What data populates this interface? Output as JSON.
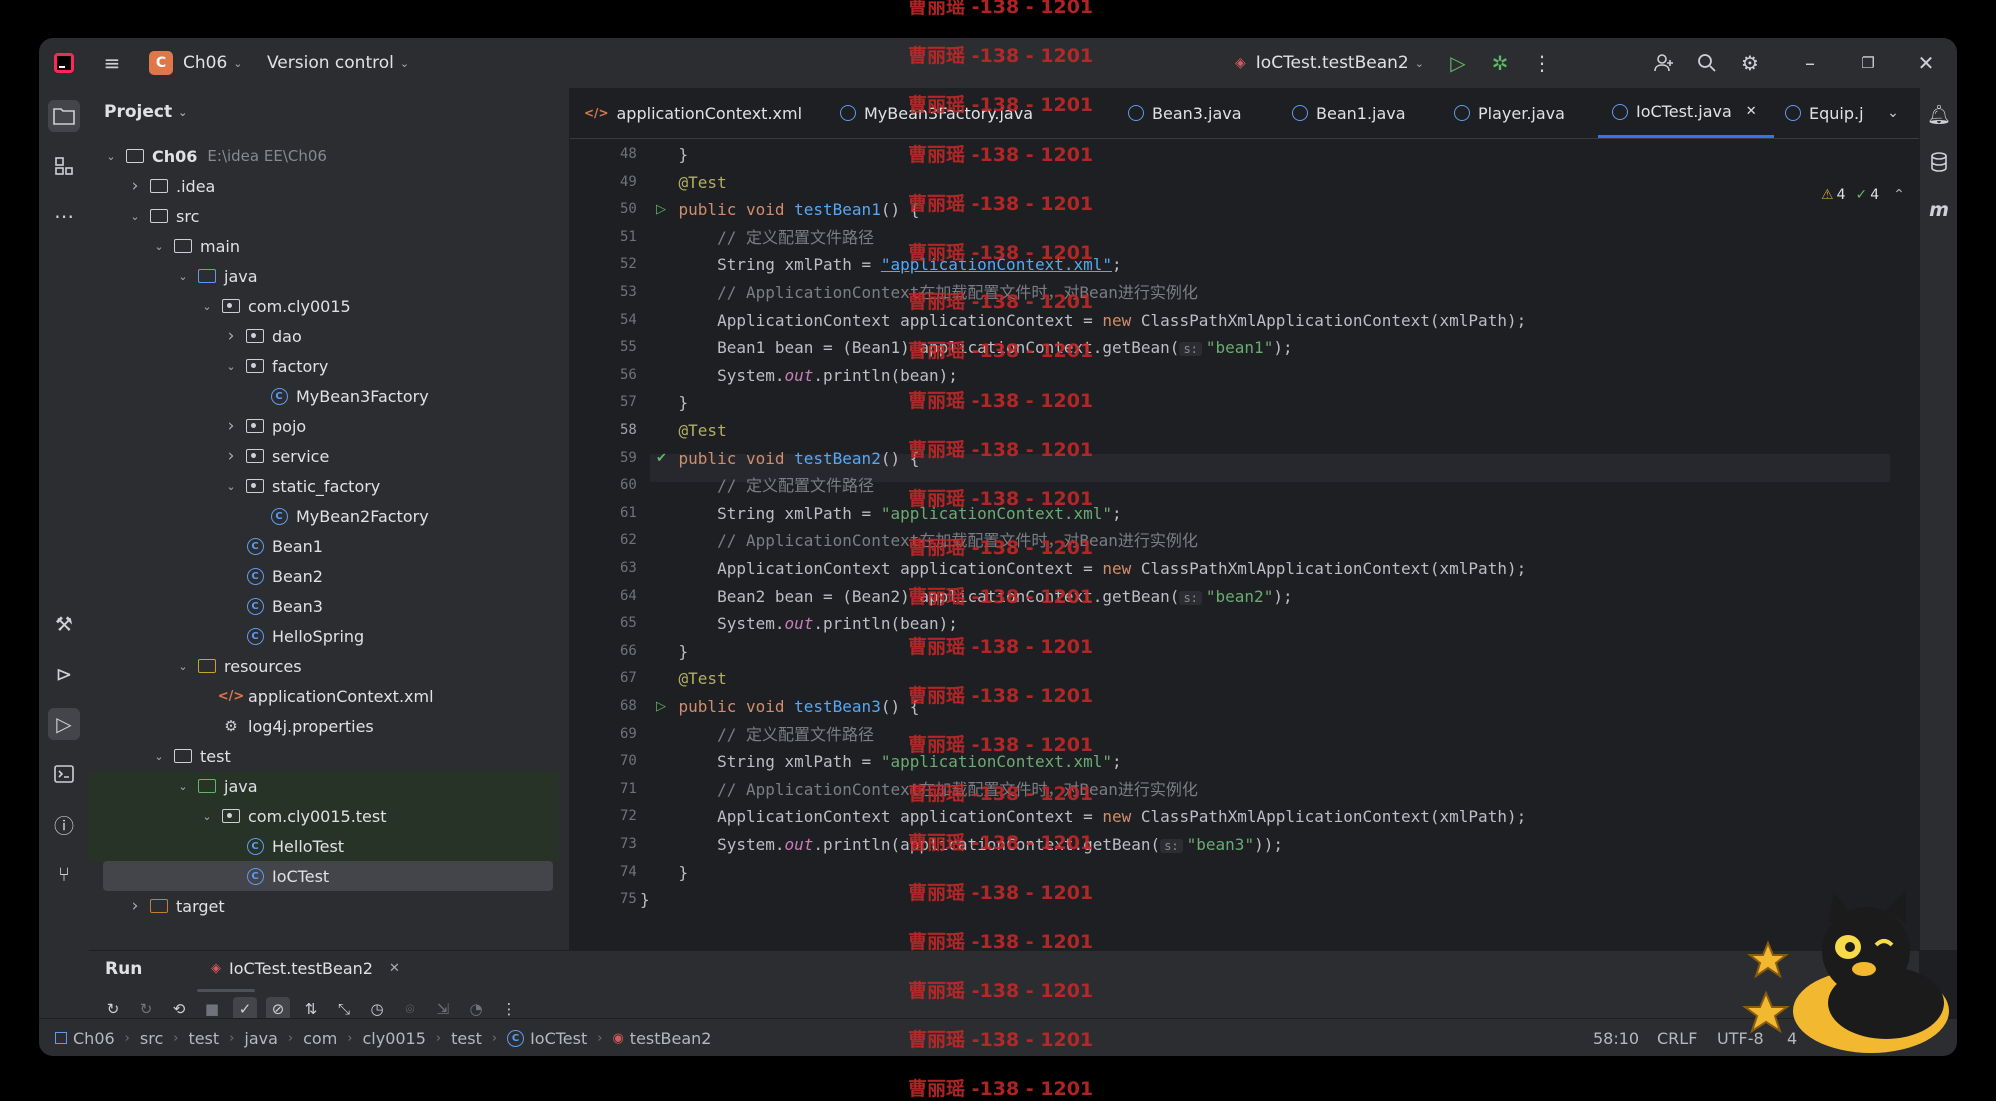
{
  "titlebar": {
    "project_initial": "C",
    "project_name": "Ch06",
    "vcs_label": "Version control",
    "run_config": "IoCTest.testBean2"
  },
  "project_panel": {
    "title": "Project",
    "tree": [
      {
        "label": "Ch06",
        "path": "E:\\idea EE\\Ch06",
        "depth": 0,
        "arrow": "down",
        "kind": "module"
      },
      {
        "label": ".idea",
        "depth": 1,
        "arrow": "right",
        "kind": "folder"
      },
      {
        "label": "src",
        "depth": 1,
        "arrow": "down",
        "kind": "folder"
      },
      {
        "label": "main",
        "depth": 2,
        "arrow": "down",
        "kind": "folder"
      },
      {
        "label": "java",
        "depth": 3,
        "arrow": "down",
        "kind": "src-folder"
      },
      {
        "label": "com.cly0015",
        "depth": 4,
        "arrow": "down",
        "kind": "package"
      },
      {
        "label": "dao",
        "depth": 5,
        "arrow": "right",
        "kind": "package"
      },
      {
        "label": "factory",
        "depth": 5,
        "arrow": "down",
        "kind": "package"
      },
      {
        "label": "MyBean3Factory",
        "depth": 6,
        "arrow": "",
        "kind": "class"
      },
      {
        "label": "pojo",
        "depth": 5,
        "arrow": "right",
        "kind": "package"
      },
      {
        "label": "service",
        "depth": 5,
        "arrow": "right",
        "kind": "package"
      },
      {
        "label": "static_factory",
        "depth": 5,
        "arrow": "down",
        "kind": "package"
      },
      {
        "label": "MyBean2Factory",
        "depth": 6,
        "arrow": "",
        "kind": "class"
      },
      {
        "label": "Bean1",
        "depth": 5,
        "arrow": "",
        "kind": "class"
      },
      {
        "label": "Bean2",
        "depth": 5,
        "arrow": "",
        "kind": "class"
      },
      {
        "label": "Bean3",
        "depth": 5,
        "arrow": "",
        "kind": "class"
      },
      {
        "label": "HelloSpring",
        "depth": 5,
        "arrow": "",
        "kind": "class"
      },
      {
        "label": "resources",
        "depth": 3,
        "arrow": "down",
        "kind": "res-folder"
      },
      {
        "label": "applicationContext.xml",
        "depth": 4,
        "arrow": "",
        "kind": "xml"
      },
      {
        "label": "log4j.properties",
        "depth": 4,
        "arrow": "",
        "kind": "props"
      },
      {
        "label": "test",
        "depth": 2,
        "arrow": "down",
        "kind": "folder"
      },
      {
        "label": "java",
        "depth": 3,
        "arrow": "down",
        "kind": "test-folder",
        "testbg": true
      },
      {
        "label": "com.cly0015.test",
        "depth": 4,
        "arrow": "down",
        "kind": "package",
        "testbg": true
      },
      {
        "label": "HelloTest",
        "depth": 5,
        "arrow": "",
        "kind": "class",
        "testbg": true
      },
      {
        "label": "IoCTest",
        "depth": 5,
        "arrow": "",
        "kind": "class",
        "selected": true
      },
      {
        "label": "target",
        "depth": 1,
        "arrow": "right",
        "kind": "folder-orange"
      }
    ]
  },
  "editor": {
    "tabs": [
      {
        "label": "applicationContext.xml",
        "kind": "xml"
      },
      {
        "label": "MyBean3Factory.java",
        "kind": "class"
      },
      {
        "label": "Bean3.java",
        "kind": "class"
      },
      {
        "label": "Bean1.java",
        "kind": "class"
      },
      {
        "label": "Player.java",
        "kind": "class"
      },
      {
        "label": "IoCTest.java",
        "kind": "class",
        "active": true
      },
      {
        "label": "Equip.j",
        "kind": "class"
      }
    ],
    "inspection": {
      "warnings": "4",
      "weak": "4"
    },
    "current_line": 58,
    "lines": [
      {
        "n": "48",
        "html": "    }"
      },
      {
        "n": "49",
        "html": "    <span class='ann'>@Test</span>"
      },
      {
        "n": "50",
        "html": "    <span class='kw'>public void </span><span class='fn'>testBean1</span>() {",
        "run": "play"
      },
      {
        "n": "51",
        "html": "        <span class='cm'>// 定义配置文件路径</span>"
      },
      {
        "n": "52",
        "html": "        String xmlPath = <span class='strlink'>\"applicationContext.xml\"</span>;"
      },
      {
        "n": "53",
        "html": "        <span class='cm'>// ApplicationContext在加载配置文件时，对Bean进行实例化</span>"
      },
      {
        "n": "54",
        "html": "        ApplicationContext applicationContext = <span class='kw'>new </span>ClassPathXmlApplicationContext(xmlPath);"
      },
      {
        "n": "55",
        "html": "        Bean1 bean = (Bean1) applicationContext.getBean(<span class='hint'>s:</span><span class='str'>\"bean1\"</span>);"
      },
      {
        "n": "56",
        "html": "        System.<span class='it'>out</span>.println(bean);"
      },
      {
        "n": "57",
        "html": "    }"
      },
      {
        "n": "58",
        "html": "    <span class='ann'>@Test</span>"
      },
      {
        "n": "59",
        "html": "    <span class='kw'>public void </span><span class='fn'>testBean2</span>() {",
        "run": "ok"
      },
      {
        "n": "60",
        "html": "        <span class='cm'>// 定义配置文件路径</span>"
      },
      {
        "n": "61",
        "html": "        String xmlPath = <span class='str'>\"applicationContext.xml\"</span>;"
      },
      {
        "n": "62",
        "html": "        <span class='cm'>// ApplicationContext在加载配置文件时，对Bean进行实例化</span>"
      },
      {
        "n": "63",
        "html": "        ApplicationContext applicationContext = <span class='kw'>new </span>ClassPathXmlApplicationContext(xmlPath);"
      },
      {
        "n": "64",
        "html": "        Bean2 bean = (Bean2) applicationContext.getBean(<span class='hint'>s:</span><span class='str'>\"bean2\"</span>);"
      },
      {
        "n": "65",
        "html": "        System.<span class='it'>out</span>.println(bean);"
      },
      {
        "n": "66",
        "html": "    }"
      },
      {
        "n": "67",
        "html": "    <span class='ann'>@Test</span>"
      },
      {
        "n": "68",
        "html": "    <span class='kw'>public void </span><span class='fn'>testBean3</span>() {",
        "run": "play"
      },
      {
        "n": "69",
        "html": "        <span class='cm'>// 定义配置文件路径</span>"
      },
      {
        "n": "70",
        "html": "        String xmlPath = <span class='str'>\"applicationContext.xml\"</span>;"
      },
      {
        "n": "71",
        "html": "        <span class='cm'>// ApplicationContext在加载配置文件时，对Bean进行实例化</span>"
      },
      {
        "n": "72",
        "html": "        ApplicationContext applicationContext = <span class='kw'>new </span>ClassPathXmlApplicationContext(xmlPath);"
      },
      {
        "n": "73",
        "html": "        System.<span class='it'>out</span>.println(applicationContext.getBean(<span class='hint'>s:</span><span class='str'>\"bean3\"</span>));"
      },
      {
        "n": "74",
        "html": "    }"
      },
      {
        "n": "75",
        "html": "}"
      }
    ]
  },
  "run_panel": {
    "title": "Run",
    "tab_label": "IoCTest.testBean2"
  },
  "statusbar": {
    "breadcrumb": [
      "Ch06",
      "src",
      "test",
      "java",
      "com",
      "cly0015",
      "test",
      "IoCTest",
      "testBean2"
    ],
    "position": "58:10",
    "line_ending": "CRLF",
    "encoding": "UTF-8",
    "indent": "4"
  },
  "watermark": {
    "text": "曹丽瑶 -138 - 1201"
  },
  "colors": {
    "accent": "#3574f0",
    "run_green": "#5fb865",
    "watermark": "#c62828",
    "project_badge": "#e0774a"
  }
}
